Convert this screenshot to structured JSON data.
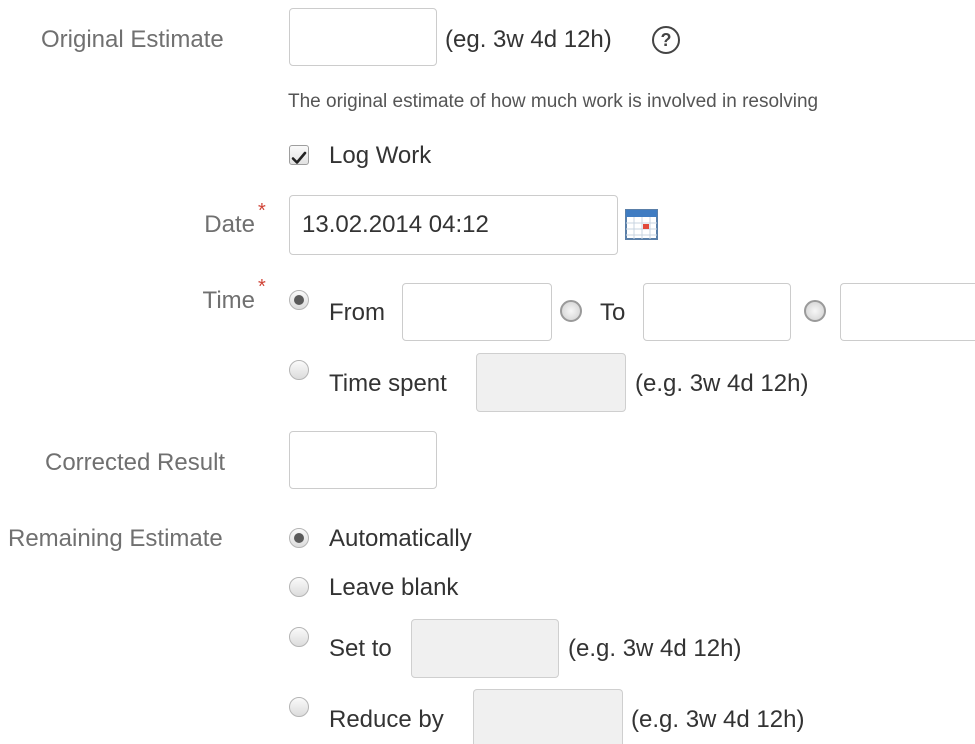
{
  "original_estimate": {
    "label": "Original Estimate",
    "value": "",
    "hint": "(eg. 3w 4d 12h)",
    "help_icon": "help-circle-icon",
    "description": "The original estimate of how much work is involved in resolving"
  },
  "log_work": {
    "label": "Log Work",
    "checked": true
  },
  "date": {
    "label": "Date",
    "required_mark": "*",
    "value": "13.02.2014 04:12",
    "icon": "calendar-icon"
  },
  "time": {
    "label": "Time",
    "required_mark": "*",
    "from_label": "From",
    "to_label": "To",
    "from_value": "",
    "to_value": "",
    "third_value": "",
    "clock_icon": "clock-icon",
    "time_spent_label": "Time spent",
    "time_spent_value": "",
    "time_spent_hint": "(e.g. 3w 4d 12h)",
    "selected": "from"
  },
  "corrected_result": {
    "label": "Corrected Result",
    "value": ""
  },
  "remaining_estimate": {
    "label": "Remaining Estimate",
    "options": [
      {
        "label": "Automatically",
        "checked": true
      },
      {
        "label": "Leave blank",
        "checked": false
      },
      {
        "label": "Set to",
        "hint": "(e.g. 3w 4d 12h)",
        "value": "",
        "checked": false
      },
      {
        "label": "Reduce by",
        "hint": "(e.g. 3w 4d 12h)",
        "value": "",
        "checked": false
      }
    ]
  }
}
